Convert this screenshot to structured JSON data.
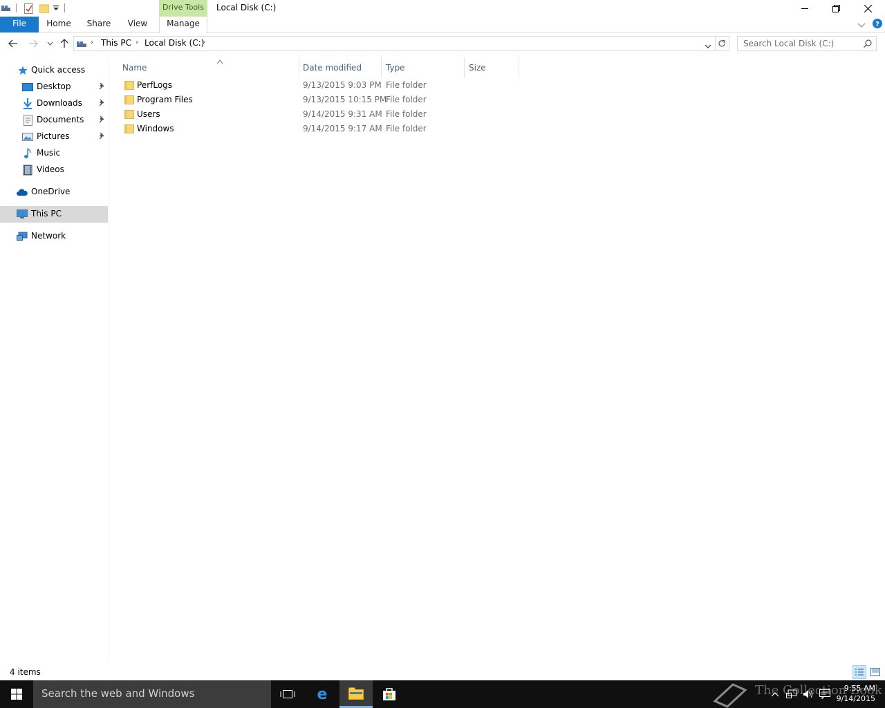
{
  "window": {
    "title": "Local Disk (C:)",
    "context_tab": "Drive Tools"
  },
  "ribbon": {
    "tabs": [
      "File",
      "Home",
      "Share",
      "View",
      "Manage"
    ]
  },
  "address": {
    "crumbs": [
      "This PC",
      "Local Disk (C:)"
    ],
    "search_placeholder": "Search Local Disk (C:)"
  },
  "navpane": {
    "quick_access": "Quick access",
    "items": [
      {
        "label": "Desktop",
        "icon": "desktop-icon",
        "pinned": true
      },
      {
        "label": "Downloads",
        "icon": "downloads-icon",
        "pinned": true
      },
      {
        "label": "Documents",
        "icon": "documents-icon",
        "pinned": true
      },
      {
        "label": "Pictures",
        "icon": "pictures-icon",
        "pinned": true
      },
      {
        "label": "Music",
        "icon": "music-icon",
        "pinned": false
      },
      {
        "label": "Videos",
        "icon": "videos-icon",
        "pinned": false
      }
    ],
    "onedrive": "OneDrive",
    "this_pc": "This PC",
    "network": "Network"
  },
  "columns": {
    "name": "Name",
    "date": "Date modified",
    "type": "Type",
    "size": "Size"
  },
  "files": [
    {
      "name": "PerfLogs",
      "date": "9/13/2015 9:03 PM",
      "type": "File folder"
    },
    {
      "name": "Program Files",
      "date": "9/13/2015 10:15 PM",
      "type": "File folder"
    },
    {
      "name": "Users",
      "date": "9/14/2015 9:31 AM",
      "type": "File folder"
    },
    {
      "name": "Windows",
      "date": "9/14/2015 9:17 AM",
      "type": "File folder"
    }
  ],
  "status": {
    "count": "4 items"
  },
  "taskbar": {
    "search_placeholder": "Search the web and Windows",
    "time": "9:55 AM",
    "date": "9/14/2015",
    "watermark": "The Collection Book"
  },
  "colors": {
    "file_tab": "#1979ca",
    "context_tab": "#c8e6a6",
    "selected_nav": "#d9d9d9",
    "taskbar": "#101010",
    "folder": "#f8d775"
  }
}
